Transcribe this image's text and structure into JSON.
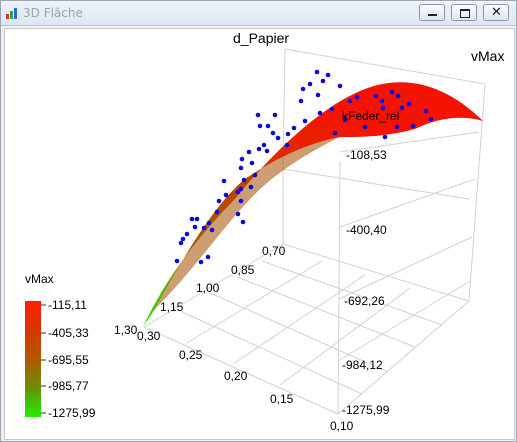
{
  "window": {
    "title": "3D Fläche",
    "buttons": {
      "minimize": "minimize-icon",
      "maximize": "maximize-icon",
      "close": "close-icon"
    }
  },
  "chart_data": {
    "type": "surface3d",
    "axes": {
      "top_label": "d_Papier",
      "right_label": "vMax",
      "inner_label": "kFeder_rel",
      "left_ticks": [
        "0,70",
        "0,85",
        "1,00",
        "1,15",
        "1,30"
      ],
      "front_ticks": [
        "0,30",
        "0,25",
        "0,20",
        "0,15",
        "0,10"
      ],
      "z_ticks": [
        "-108,53",
        "-400,40",
        "-692,26",
        "-984,12",
        "-1275,99"
      ],
      "zlim": [
        -1275.99,
        -108.53
      ]
    },
    "legend": {
      "title": "vMax",
      "placement": "left",
      "values": [
        "-115,11",
        "-405,33",
        "-695,55",
        "-985,77",
        "-1275,99"
      ],
      "colors": [
        "#ff1e00",
        "#d83600",
        "#b05800",
        "#6a8f00",
        "#23ee00"
      ]
    },
    "surface_colors": {
      "high": "#f01a00",
      "low": "#2fd600"
    },
    "points": {
      "color": "#0a0ad8",
      "count": 68
    }
  }
}
